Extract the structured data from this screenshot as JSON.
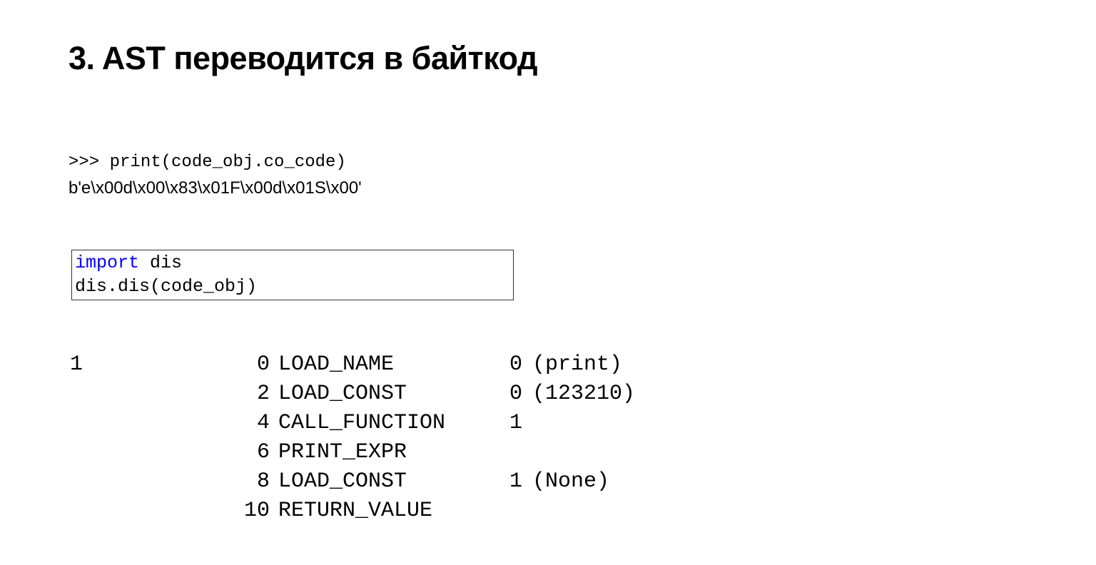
{
  "title": "3. AST переводится в байткод",
  "repl": {
    "line1": ">>> print(code_obj.co_code)",
    "line2": "b'e\\x00d\\x00\\x83\\x01F\\x00d\\x01S\\x00'"
  },
  "code_box": {
    "import_kw": "import",
    "import_rest": " dis",
    "line2": "dis.dis(code_obj)"
  },
  "bytecode": {
    "rows": [
      {
        "line": "1",
        "offset": "0",
        "op": "LOAD_NAME",
        "arg": "0",
        "argval": "(print)"
      },
      {
        "line": "",
        "offset": "2",
        "op": "LOAD_CONST",
        "arg": "0",
        "argval": "(123210)"
      },
      {
        "line": "",
        "offset": "4",
        "op": "CALL_FUNCTION",
        "arg": "1",
        "argval": ""
      },
      {
        "line": "",
        "offset": "6",
        "op": "PRINT_EXPR",
        "arg": "",
        "argval": ""
      },
      {
        "line": "",
        "offset": "8",
        "op": "LOAD_CONST",
        "arg": "1",
        "argval": "(None)"
      },
      {
        "line": "",
        "offset": "10",
        "op": "RETURN_VALUE",
        "arg": "",
        "argval": ""
      }
    ]
  }
}
